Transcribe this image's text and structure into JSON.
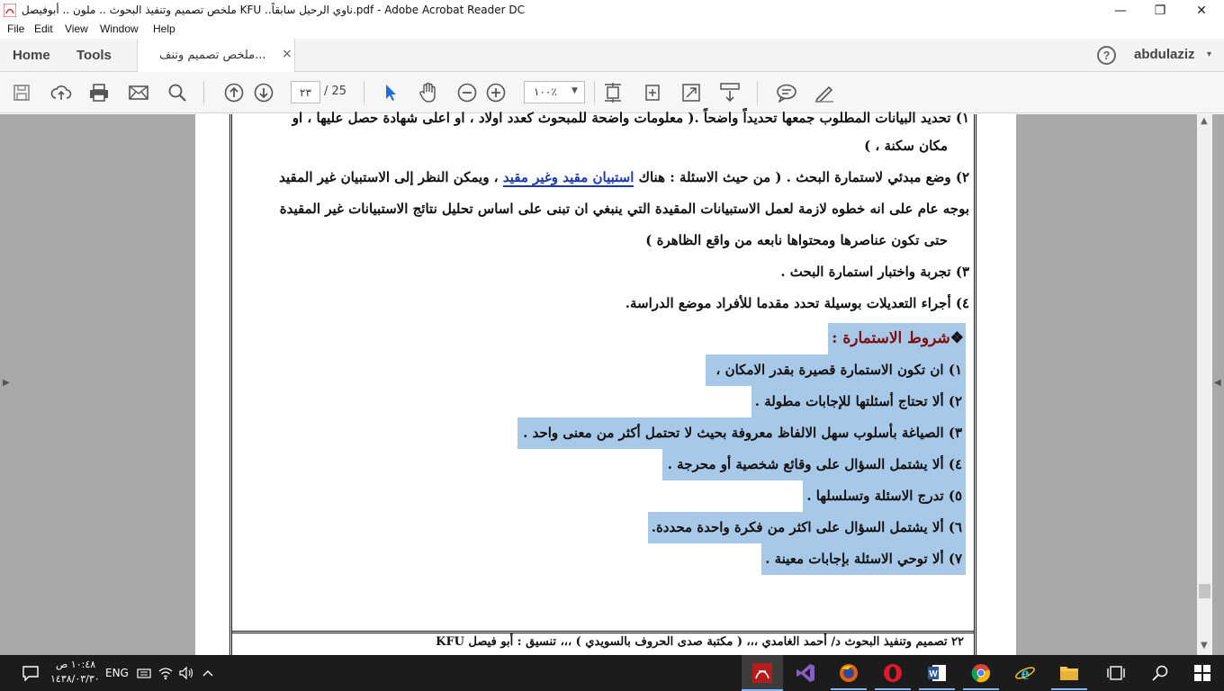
{
  "window": {
    "title": "ملخص تصميم وتنفيذ البحوث .. ملون .. أبوفيصل KFU ..ناوي الرحيل سابقاً.pdf - Adobe Acrobat Reader DC",
    "minimize": "—",
    "maximize": "❐",
    "close": "✕"
  },
  "menu": {
    "file": "File",
    "edit": "Edit",
    "view": "View",
    "window": "Window",
    "help": "Help"
  },
  "tabs": {
    "home": "Home",
    "tools": "Tools",
    "doc_label": "ملخص تصميم وتنف...",
    "doc_close": "×",
    "help": "?",
    "user": "abdulaziz",
    "user_caret": "▾"
  },
  "toolbar": {
    "page_current": "٢٣",
    "page_total": "/ 25",
    "zoom": "١٠٠٪",
    "zoom_caret": "▼"
  },
  "document": {
    "lines": [
      {
        "text": "١) تحديد البيانات المطلوب جمعها تحديداً واضحاً .( معلومات واضحة للمبحوث كعدد اولاد ، او اعلى شهادة حصل عليها ، او",
        "highlight": false
      },
      {
        "text": "مكان سكنة ، )",
        "highlight": false
      },
      {
        "text_before": "٢) وضع مبدئي لاستمارة البحث . ( من حيث الاسئلة : هناك ",
        "link": "استبيان مقيد وغير مقيد",
        "text_after": " ، ويمكن النظر إلى الاستبيان غير المقيد"
      },
      {
        "text": "بوجه عام على انه خطوه لازمة لعمل الاستبيانات المقيدة التي ينبغي ان تبنى على اساس تحليل نتائج الاستبيانات غير المقيدة",
        "highlight": false
      },
      {
        "text": "حتى تكون عناصرها ومحتواها نابعه من واقع الظاهرة )",
        "highlight": false
      },
      {
        "text": "٣) تجربة واختبار استمارة البحث .",
        "highlight": false
      },
      {
        "text": "٤) أجراء التعديلات بوسيلة تحدد مقدما للأفراد موضع الدراسة.",
        "highlight": false
      }
    ],
    "heading": "شروط الاستمارة :",
    "heading_bullet": "❖",
    "conditions": [
      "١) ان تكون الاستمارة قصيرة بقدر الامكان ،",
      "٢) ألا تحتاج أسئلتها للإجابات مطولة .",
      "٣) الصياغة بأسلوب سهل الالفاظ معروفة بحيث لا تحتمل أكثر من معنى واحد .",
      "٤) ألا يشتمل السؤال على وقائع شخصية أو محرجة .",
      "٥) تدرج الاسئلة وتسلسلها .",
      "٦) ألا يشتمل السؤال على اكثر من فكرة واحدة محددة.",
      "٧) ألا توحي الاسئلة بإجابات معينة ."
    ],
    "footer": "٢٢   تصميم وتنفيذ البحوث  د/ أحمد الغامدي       ،،،       ( مكتبة صدى الحروف بالسويدي )       ،،،      تنسيق : أبو فيصل KFU"
  },
  "taskbar": {
    "lang": "ENG",
    "time": "١٠:٤٨ ص",
    "date": "١٤٣٨/٠٣/٣٠"
  },
  "colors": {
    "highlight": "#a8c8e8",
    "heading": "#7a1010",
    "link": "#1a3aa8",
    "acrobat_red": "#d32f2f"
  }
}
